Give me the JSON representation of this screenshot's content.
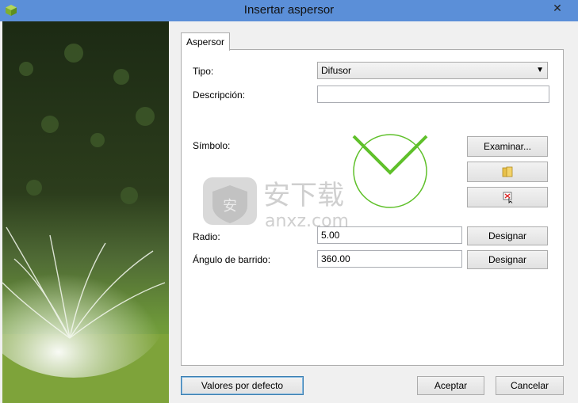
{
  "window": {
    "title": "Insertar aspersor",
    "close_glyph": "✕",
    "app_icon": "app-cube-icon"
  },
  "tabs": [
    {
      "label": "Aspersor"
    }
  ],
  "form": {
    "tipo_label": "Tipo:",
    "tipo_value": "Difusor",
    "descripcion_label": "Descripción:",
    "descripcion_value": "",
    "simbolo_label": "Símbolo:",
    "examinar_label": "Examinar...",
    "radio_label": "Radio:",
    "radio_value": "5.00",
    "angulo_label": "Ángulo de barrido:",
    "angulo_value": "360.00",
    "designar_label": "Designar"
  },
  "footer": {
    "defaults_label": "Valores por defecto",
    "accept_label": "Aceptar",
    "cancel_label": "Cancelar"
  },
  "watermark": {
    "brand_cn": "安下载",
    "brand_url": "anxz.com"
  },
  "colors": {
    "titlebar": "#5b8fd8",
    "symbol_green": "#5fc02a"
  }
}
